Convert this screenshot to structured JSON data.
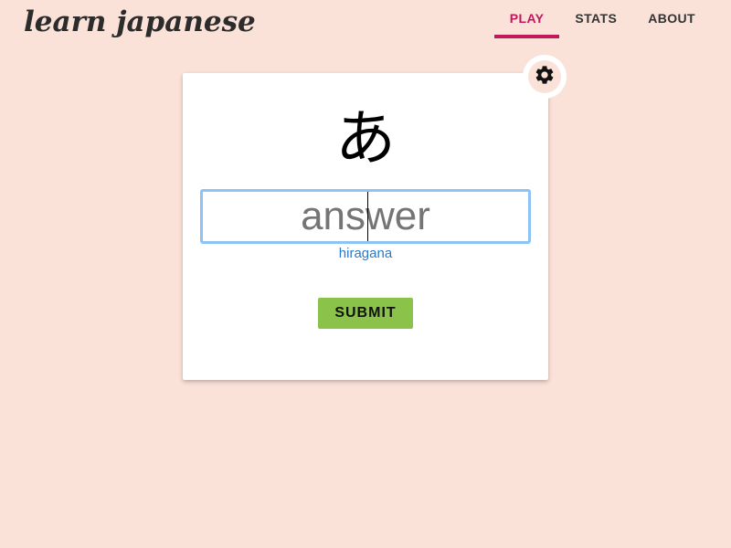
{
  "header": {
    "logo_text": "learn japanese",
    "tabs": [
      {
        "label": "PLAY",
        "active": true
      },
      {
        "label": "STATS",
        "active": false
      },
      {
        "label": "ABOUT",
        "active": false
      }
    ]
  },
  "quiz": {
    "character": "あ",
    "answer_value": "",
    "answer_placeholder": "answer",
    "hint_label": "hiragana",
    "submit_label": "SUBMIT",
    "settings_icon": "gear-icon"
  },
  "colors": {
    "background": "#fae2d9",
    "accent": "#c2185b",
    "submit": "#8bc34a",
    "hint": "#2a7ac9",
    "input_focus": "#8ec4f5"
  }
}
